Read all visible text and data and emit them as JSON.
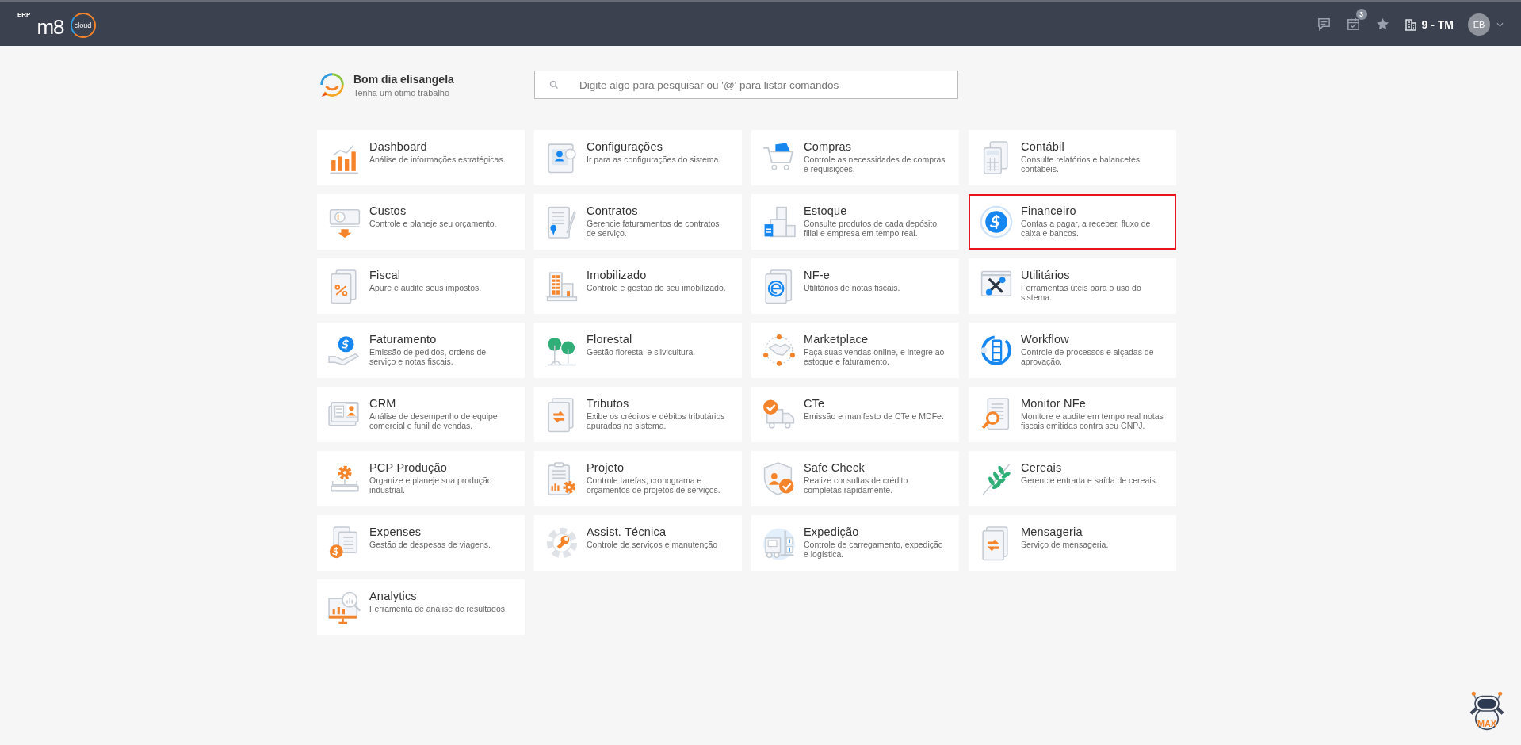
{
  "header": {
    "logo": {
      "prefix": "ERP",
      "mark": "m8",
      "suffix": "cloud"
    },
    "notifications_badge": "3",
    "company": "9 - TM",
    "avatar": "EB"
  },
  "greeting": {
    "title": "Bom dia elisangela",
    "subtitle": "Tenha um ótimo trabalho"
  },
  "search": {
    "placeholder": "Digite algo para pesquisar ou '@' para listar comandos"
  },
  "modules": [
    {
      "title": "Dashboard",
      "description": "Análise de informações estratégicas.",
      "selected": false
    },
    {
      "title": "Configurações",
      "description": "Ir para as configurações do sistema.",
      "selected": false
    },
    {
      "title": "Compras",
      "description": "Controle as necessidades de compras e requisições.",
      "selected": false
    },
    {
      "title": "Contábil",
      "description": "Consulte relatórios e balancetes contábeis.",
      "selected": false
    },
    {
      "title": "Custos",
      "description": "Controle e planeje seu orçamento.",
      "selected": false
    },
    {
      "title": "Contratos",
      "description": "Gerencie faturamentos de contratos de serviço.",
      "selected": false
    },
    {
      "title": "Estoque",
      "description": "Consulte produtos de cada depósito, filial e empresa em tempo real.",
      "selected": false
    },
    {
      "title": "Financeiro",
      "description": "Contas a pagar, a receber, fluxo de caixa e bancos.",
      "selected": true
    },
    {
      "title": "Fiscal",
      "description": "Apure e audite seus impostos.",
      "selected": false
    },
    {
      "title": "Imobilizado",
      "description": "Controle e gestão do seu imobilizado.",
      "selected": false
    },
    {
      "title": "NF-e",
      "description": "Utilitários de notas fiscais.",
      "selected": false
    },
    {
      "title": "Utilitários",
      "description": "Ferramentas úteis para o uso do sistema.",
      "selected": false
    },
    {
      "title": "Faturamento",
      "description": "Emissão de pedidos, ordens de serviço e notas fiscais.",
      "selected": false
    },
    {
      "title": "Florestal",
      "description": "Gestão florestal e silvicultura.",
      "selected": false
    },
    {
      "title": "Marketplace",
      "description": "Faça suas vendas online, e integre ao estoque e faturamento.",
      "selected": false
    },
    {
      "title": "Workflow",
      "description": "Controle de processos e alçadas de aprovação.",
      "selected": false
    },
    {
      "title": "CRM",
      "description": "Análise de desempenho de equipe comercial e funil de vendas.",
      "selected": false
    },
    {
      "title": "Tributos",
      "description": "Exibe os créditos e débitos tributários apurados no sistema.",
      "selected": false
    },
    {
      "title": "CTe",
      "description": "Emissão e manifesto de CTe e MDFe.",
      "selected": false
    },
    {
      "title": "Monitor NFe",
      "description": "Monitore e audite em tempo real notas fiscais emitidas contra seu CNPJ.",
      "selected": false
    },
    {
      "title": "PCP Produção",
      "description": "Organize e planeje sua produção industrial.",
      "selected": false
    },
    {
      "title": "Projeto",
      "description": "Controle tarefas, cronograma e orçamentos de projetos de serviços.",
      "selected": false
    },
    {
      "title": "Safe Check",
      "description": "Realize consultas de crédito completas rapidamente.",
      "selected": false
    },
    {
      "title": "Cereais",
      "description": "Gerencie entrada e saída de cereais.",
      "selected": false
    },
    {
      "title": "Expenses",
      "description": "Gestão de despesas de viagens.",
      "selected": false
    },
    {
      "title": "Assist. Técnica",
      "description": "Controle de serviços e manutenção",
      "selected": false
    },
    {
      "title": "Expedição",
      "description": "Controle de carregamento, expedição e logística.",
      "selected": false
    },
    {
      "title": "Mensageria",
      "description": "Serviço de mensageria.",
      "selected": false
    },
    {
      "title": "Analytics",
      "description": "Ferramenta de análise de resultados",
      "selected": false
    }
  ],
  "assistant": {
    "label": "MAX"
  }
}
